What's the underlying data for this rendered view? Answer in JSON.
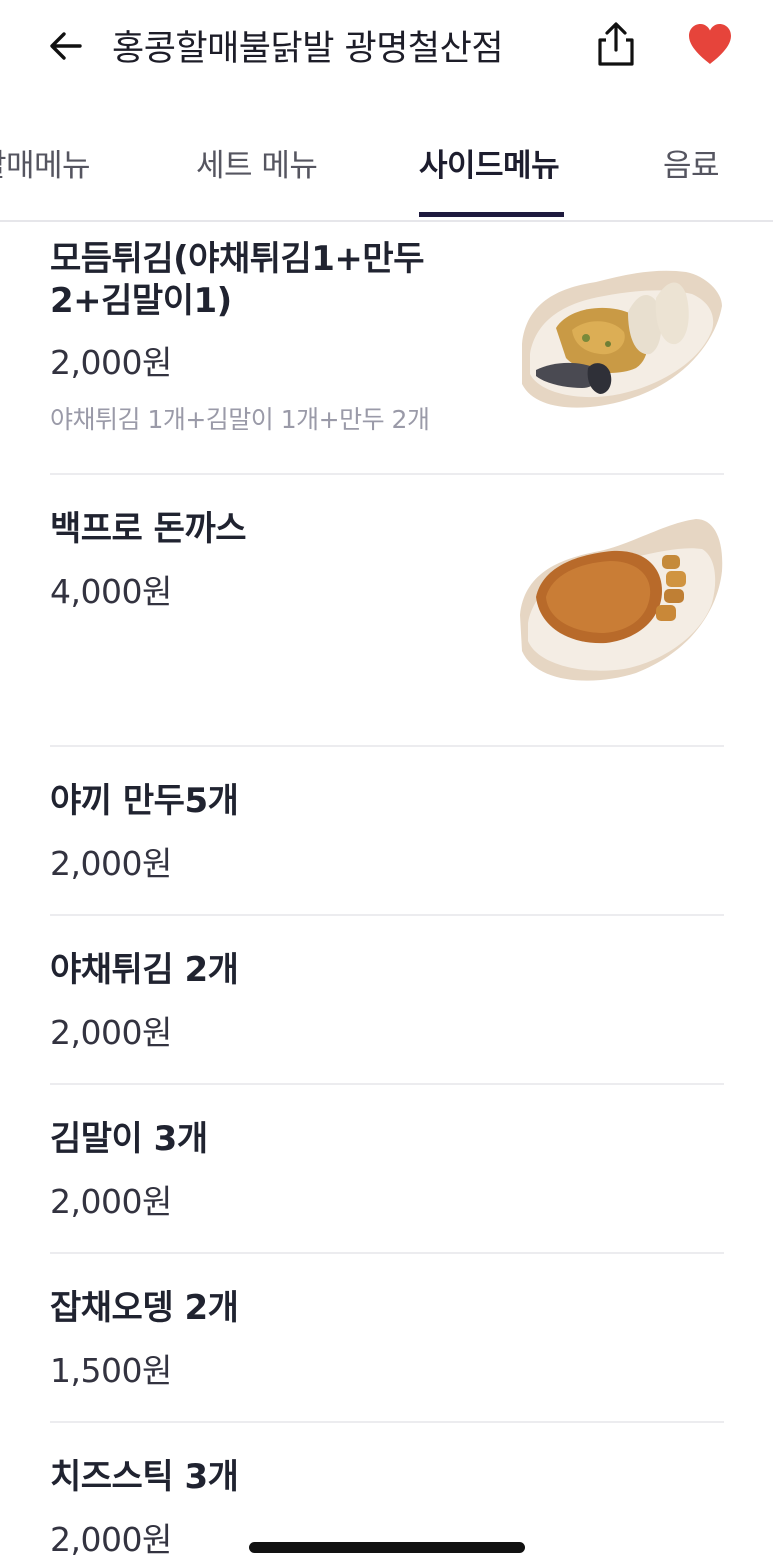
{
  "header": {
    "title": "홍콩할매불닭발 광명철산점",
    "back_icon": "arrow-left-icon",
    "share_icon": "share-icon",
    "favorite_icon": "heart-icon",
    "favorite_color": "#e6443b"
  },
  "tabs": [
    {
      "label": "할매메뉴"
    },
    {
      "label": "세트 메뉴"
    },
    {
      "label": "사이드메뉴",
      "active": true
    },
    {
      "label": "음료"
    }
  ],
  "menu": [
    {
      "name_line1": "모듬튀김(야채튀김1+만두",
      "name_line2": "2+김말이1)",
      "price": "2,000원",
      "description": "야채튀김 1개+김말이 1개+만두 2개",
      "image": "fried-assortment-photo"
    },
    {
      "name": "백프로 돈까스",
      "price": "4,000원",
      "image": "pork-cutlet-photo"
    },
    {
      "name": "야끼 만두5개",
      "price": "2,000원"
    },
    {
      "name": "야채튀김 2개",
      "price": "2,000원"
    },
    {
      "name": "김말이 3개",
      "price": "2,000원"
    },
    {
      "name": "잡채오뎅 2개",
      "price": "1,500원"
    },
    {
      "name": "치즈스틱 3개",
      "price": "2,000원"
    }
  ],
  "colors": {
    "accent": "#1e1a3e",
    "heart": "#e6443b",
    "divider": "#ececef"
  }
}
